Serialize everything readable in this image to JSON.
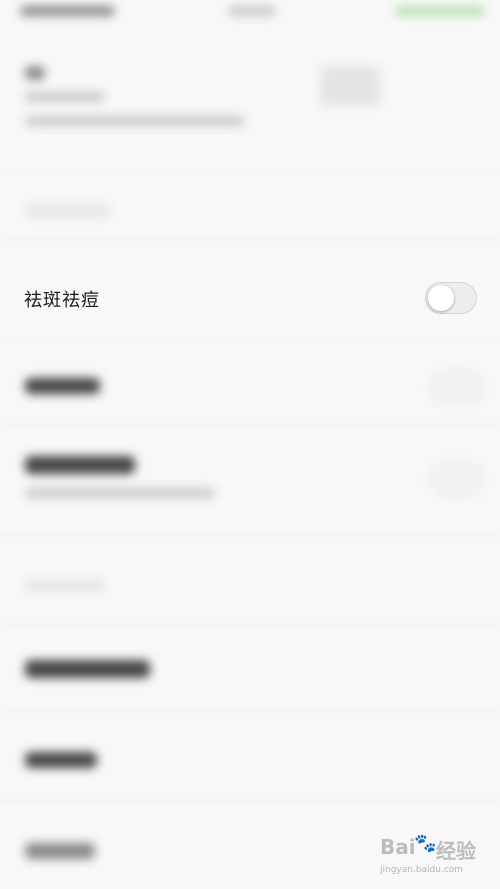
{
  "setting": {
    "label": "祛斑祛痘",
    "toggle_on": false
  },
  "watermark": {
    "brand": "Bai",
    "paw": "🐾",
    "suffix": "经验",
    "url": "jingyan.baidu.com"
  }
}
